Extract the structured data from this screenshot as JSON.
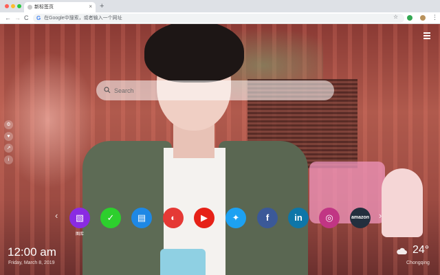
{
  "browser": {
    "tab_title": "新标签页",
    "tab_close": "×",
    "new_tab": "+",
    "back": "←",
    "forward": "→",
    "reload": "C",
    "omnibox_placeholder": "在Google中搜索，或者输入一个网址",
    "bookmark_star": "☆",
    "menu": "⋮"
  },
  "search": {
    "placeholder": "Search"
  },
  "side_icons": [
    {
      "icon": "settings-icon",
      "glyph": "⚙"
    },
    {
      "icon": "heart-icon",
      "glyph": "♥"
    },
    {
      "icon": "share-icon",
      "glyph": "↗"
    },
    {
      "icon": "info-icon",
      "glyph": "i"
    }
  ],
  "shortcuts": [
    {
      "name": "gallery",
      "color": "#8a2be2",
      "glyph": "▧",
      "label": "图库"
    },
    {
      "name": "tasks",
      "color": "#2dcf2d",
      "glyph": "✓"
    },
    {
      "name": "news",
      "color": "#1e88e5",
      "glyph": "▤"
    },
    {
      "name": "games",
      "color": "#e53935",
      "glyph": "◐"
    },
    {
      "name": "youtube",
      "color": "#e62117",
      "glyph": "▶"
    },
    {
      "name": "twitter",
      "color": "#1da1f2",
      "glyph": "✦"
    },
    {
      "name": "facebook",
      "color": "#3b5998",
      "glyph": "f"
    },
    {
      "name": "linkedin",
      "color": "#0e76a8",
      "glyph": "in"
    },
    {
      "name": "instagram",
      "color": "#c13584",
      "glyph": "◎"
    },
    {
      "name": "amazon",
      "color": "#232f3e",
      "glyph": "amazon"
    }
  ],
  "nav_arrows": {
    "left": "‹",
    "right": "›"
  },
  "clock": {
    "time": "12:00 am",
    "date": "Friday, March 8, 2019"
  },
  "weather": {
    "temp": "24°",
    "city": "Chongqing"
  }
}
